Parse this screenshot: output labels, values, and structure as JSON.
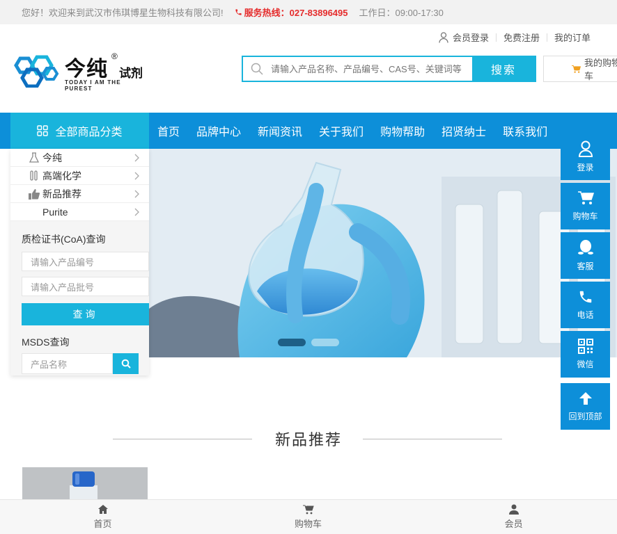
{
  "topbar": {
    "welcome": "您好！欢迎来到武汉市伟琪博星生物科技有限公司!",
    "hotline": "服务热线：027-83896495",
    "hours": "工作日：09:00-17:30"
  },
  "userlinks": {
    "login": "会员登录",
    "register": "免费注册",
    "orders": "我的订单"
  },
  "logo": {
    "brand": "今纯",
    "reg": "®",
    "sub": "试剂",
    "slogan": "TODAY I AM THE PUREST"
  },
  "search": {
    "placeholder": "请输入产品名称、产品编号、CAS号、关键词等",
    "button": "搜索"
  },
  "cart_top": {
    "label": "我的购物车"
  },
  "nav": {
    "all_categories": "全部商品分类",
    "items": [
      "首页",
      "品牌中心",
      "新闻资讯",
      "关于我们",
      "购物帮助",
      "招贤纳士",
      "联系我们"
    ]
  },
  "categories": [
    "今纯",
    "高端化学",
    "新品推荐",
    "Purite"
  ],
  "coa": {
    "title": "质检证书(CoA)查询",
    "product_no_placeholder": "请输入产品编号",
    "batch_no_placeholder": "请输入产品批号",
    "query_button": "查询",
    "msds_title": "MSDS查询",
    "msds_placeholder": "产品名称"
  },
  "floatbar": [
    "登录",
    "购物车",
    "客服",
    "电话",
    "微信",
    "回到顶部"
  ],
  "section": {
    "title": "新品推荐"
  },
  "bottombar": [
    "首页",
    "购物车",
    "会员"
  ],
  "colors": {
    "accent": "#19b4dc",
    "nav": "#0d8fd9",
    "hotline": "#e52b2b"
  }
}
